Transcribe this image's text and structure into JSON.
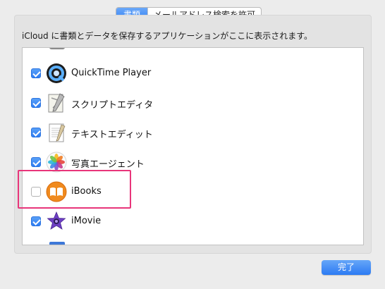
{
  "tabs": [
    {
      "label": "書類",
      "active": true
    },
    {
      "label": "メールアドレス検索を許可",
      "active": false
    }
  ],
  "description": "iCloud に書類とデータを保存するアプリケーションがここに表示されます。",
  "apps": [
    {
      "name": "QuickTime Player",
      "checked": true,
      "icon": "quicktime-icon"
    },
    {
      "name": "スクリプトエディタ",
      "checked": true,
      "icon": "script-editor-icon"
    },
    {
      "name": "テキストエディット",
      "checked": true,
      "icon": "textedit-icon"
    },
    {
      "name": "写真エージェント",
      "checked": true,
      "icon": "photos-icon"
    },
    {
      "name": "iBooks",
      "checked": false,
      "icon": "ibooks-icon"
    },
    {
      "name": "iMovie",
      "checked": true,
      "icon": "imovie-icon"
    }
  ],
  "done_label": "完了",
  "colors": {
    "accent": "#2f7df4",
    "highlight": "#e8357a"
  }
}
